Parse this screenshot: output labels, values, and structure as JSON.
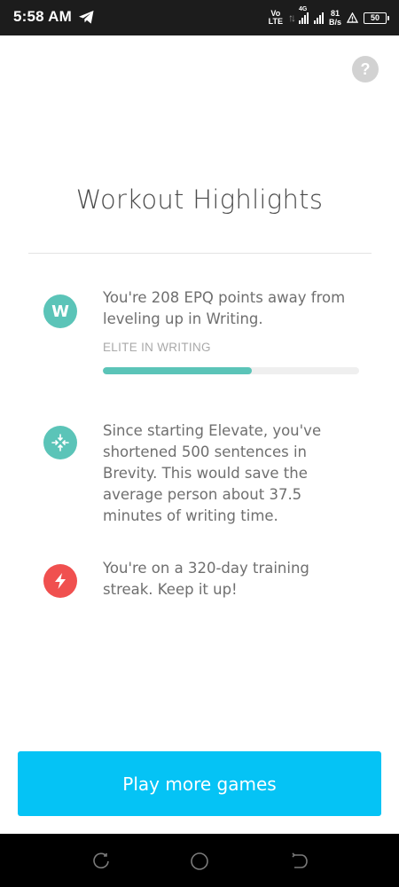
{
  "status_bar": {
    "time": "5:58 AM",
    "volte_top": "Vo",
    "volte_bottom": "LTE",
    "network_type": "4G",
    "speed_value": "81",
    "speed_unit": "B/s",
    "battery": "50"
  },
  "help": {
    "label": "?"
  },
  "page_title": "Workout Highlights",
  "highlights": [
    {
      "icon": "letter-w-icon",
      "icon_letter": "W",
      "icon_color": "#5bc4b8",
      "text": "You're 208 EPQ points away from leveling up in Writing.",
      "sublabel": "ELITE IN WRITING",
      "progress": 0.58
    },
    {
      "icon": "compress-arrows-icon",
      "icon_color": "#5bc4b8",
      "text": "Since starting Elevate, you've shortened 500 sentences in Brevity. This would save the average person about 37.5 minutes of writing time."
    },
    {
      "icon": "lightning-bolt-icon",
      "icon_color": "#f0504f",
      "text": "You're on a 320-day training streak. Keep it up!"
    }
  ],
  "cta": {
    "label": "Play more games",
    "color": "#05c3f5"
  },
  "nav": [
    "recent-apps-icon",
    "home-icon",
    "back-icon"
  ]
}
